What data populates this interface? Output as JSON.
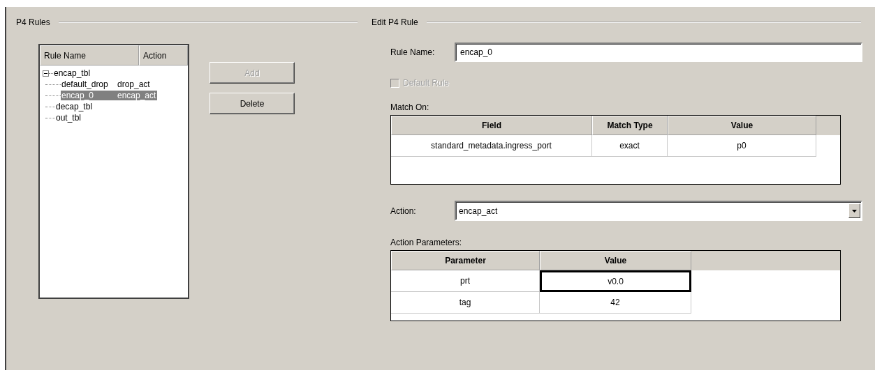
{
  "rules_panel": {
    "title": "P4 Rules",
    "tree": {
      "columns": [
        "Rule Name",
        "Action"
      ],
      "items": [
        {
          "name": "encap_tbl",
          "expanded": true,
          "selected": false,
          "children": [
            {
              "name": "default_drop",
              "action": "drop_act",
              "selected": false
            },
            {
              "name": "encap_0",
              "action": "encap_act",
              "selected": true
            }
          ]
        },
        {
          "name": "decap_tbl",
          "selected": false
        },
        {
          "name": "out_tbl",
          "selected": false
        }
      ]
    },
    "buttons": [
      {
        "label": "Add",
        "disabled": true
      },
      {
        "label": "Delete",
        "disabled": false
      }
    ]
  },
  "edit_panel": {
    "title": "Edit P4 Rule",
    "rule_name": {
      "label": "Rule Name:",
      "value": "encap_0"
    },
    "default_rule": {
      "label": "Default Rule",
      "checked": false,
      "disabled": true
    },
    "match_on": {
      "label": "Match On:",
      "columns": [
        "Field",
        "Match Type",
        "Value"
      ],
      "rows": [
        {
          "cells": [
            "standard_metadata.ingress_port",
            "exact",
            "p0"
          ]
        }
      ]
    },
    "action": {
      "label": "Action:",
      "value": "encap_act"
    },
    "action_parameters": {
      "label": "Action Parameters:",
      "columns": [
        "Parameter",
        "Value"
      ],
      "rows": [
        {
          "parameter": "prt",
          "value": "v0.0",
          "editing": true
        },
        {
          "parameter": "tag",
          "value": "42",
          "editing": false
        }
      ]
    }
  }
}
